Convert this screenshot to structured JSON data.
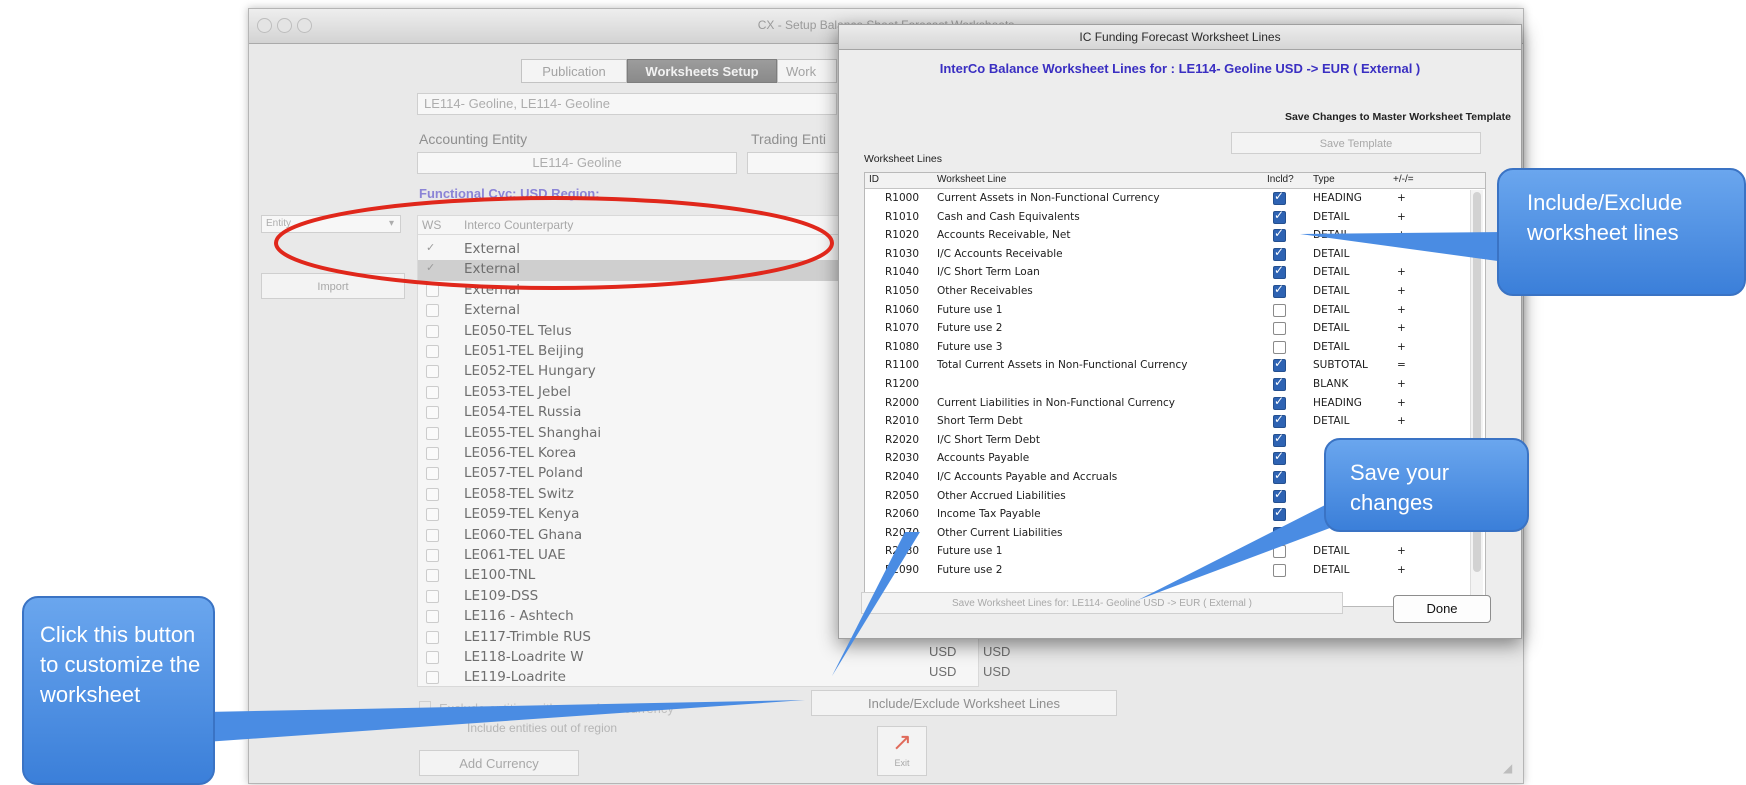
{
  "main_window": {
    "title": "CX - Setup Balance Sheet Forecast Worksheets",
    "tabs": [
      "Publication",
      "Worksheets Setup",
      "Work"
    ],
    "entity_combo": "LE114- Geoline, LE114- Geoline",
    "accounting_entity_label": "Accounting Entity",
    "accounting_entity_value": "LE114- Geoline",
    "trading_entity_label": "Trading Enti",
    "functional_ccy_label": "Functional Cyc: USD  Region:",
    "left_dropdown": "Entity",
    "left_button": "Import",
    "list_header_ws": "WS",
    "list_header_name": "Interco Counterparty",
    "counterparties": [
      {
        "name": "External",
        "checked": true
      },
      {
        "name": "External",
        "checked": true
      },
      {
        "name": "External",
        "checked": false
      },
      {
        "name": "External",
        "checked": false
      },
      {
        "name": "LE050-TEL Telus",
        "checked": false
      },
      {
        "name": "LE051-TEL Beijing",
        "checked": false
      },
      {
        "name": "LE052-TEL Hungary",
        "checked": false
      },
      {
        "name": "LE053-TEL Jebel",
        "checked": false
      },
      {
        "name": "LE054-TEL Russia",
        "checked": false
      },
      {
        "name": "LE055-TEL Shanghai",
        "checked": false
      },
      {
        "name": "LE056-TEL Korea",
        "checked": false
      },
      {
        "name": "LE057-TEL Poland",
        "checked": false
      },
      {
        "name": "LE058-TEL Switz",
        "checked": false
      },
      {
        "name": "LE059-TEL Kenya",
        "checked": false
      },
      {
        "name": "LE060-TEL Ghana",
        "checked": false
      },
      {
        "name": "LE061-TEL UAE",
        "checked": false
      },
      {
        "name": "LE100-TNL",
        "checked": false
      },
      {
        "name": "LE109-DSS",
        "checked": false
      },
      {
        "name": "LE116 - Ashtech",
        "checked": false
      },
      {
        "name": "LE117-Trimble RUS",
        "checked": false
      },
      {
        "name": "LE118-Loadrite W",
        "checked": false
      },
      {
        "name": "LE119-Loadrite",
        "checked": false
      }
    ],
    "currency_rows": [
      [
        "USD",
        "USD"
      ],
      [
        "USD",
        "USD"
      ],
      [
        "USD",
        "USD"
      ]
    ],
    "exclude_checkbox_label": "Exclude entities with same func currency",
    "exclude_sub_label": "Include entities out of region",
    "include_exclude_button": "Include/Exclude Worksheet Lines",
    "add_currency_button": "Add Currency",
    "exit_label": "Exit"
  },
  "dialog": {
    "title": "IC Funding Forecast Worksheet Lines",
    "subtitle": "InterCo Balance Worksheet Lines for : LE114- Geoline USD -> EUR ( External )",
    "save_template_label": "Save Changes to Master Worksheet Template",
    "save_template_button": "Save Template",
    "worksheet_lines_label": "Worksheet Lines",
    "columns": {
      "id": "ID",
      "line": "Worksheet Line",
      "incl": "Incld?",
      "type": "Type",
      "sign": "+/-/="
    },
    "rows": [
      {
        "id": "R1000",
        "line": "Current Assets in Non-Functional Currency",
        "incl": true,
        "type": "HEADING",
        "sign": "+"
      },
      {
        "id": "R1010",
        "line": "Cash and Cash Equivalents",
        "incl": true,
        "type": "DETAIL",
        "sign": "+"
      },
      {
        "id": "R1020",
        "line": "Accounts Receivable, Net",
        "incl": true,
        "type": "DETAIL",
        "sign": "+"
      },
      {
        "id": "R1030",
        "line": "I/C Accounts Receivable",
        "incl": true,
        "type": "DETAIL",
        "sign": ""
      },
      {
        "id": "R1040",
        "line": "I/C Short Term Loan",
        "incl": true,
        "type": "DETAIL",
        "sign": "+"
      },
      {
        "id": "R1050",
        "line": "Other Receivables",
        "incl": true,
        "type": "DETAIL",
        "sign": "+"
      },
      {
        "id": "R1060",
        "line": "Future use 1",
        "incl": false,
        "type": "DETAIL",
        "sign": "+"
      },
      {
        "id": "R1070",
        "line": "Future use 2",
        "incl": false,
        "type": "DETAIL",
        "sign": "+"
      },
      {
        "id": "R1080",
        "line": "Future use 3",
        "incl": false,
        "type": "DETAIL",
        "sign": "+"
      },
      {
        "id": "R1100",
        "line": "Total Current Assets in Non-Functional Currency",
        "incl": true,
        "type": "SUBTOTAL",
        "sign": "="
      },
      {
        "id": "R1200",
        "line": "",
        "incl": true,
        "type": "BLANK",
        "sign": "+"
      },
      {
        "id": "R2000",
        "line": "Current Liabilities in Non-Functional Currency",
        "incl": true,
        "type": "HEADING",
        "sign": "+"
      },
      {
        "id": "R2010",
        "line": "Short Term Debt",
        "incl": true,
        "type": "DETAIL",
        "sign": "+"
      },
      {
        "id": "R2020",
        "line": "I/C Short Term Debt",
        "incl": true,
        "type": "",
        "sign": ""
      },
      {
        "id": "R2030",
        "line": "Accounts Payable",
        "incl": true,
        "type": "",
        "sign": ""
      },
      {
        "id": "R2040",
        "line": "I/C Accounts Payable and Accruals",
        "incl": true,
        "type": "",
        "sign": ""
      },
      {
        "id": "R2050",
        "line": "Other Accrued Liabilities",
        "incl": true,
        "type": "",
        "sign": ""
      },
      {
        "id": "R2060",
        "line": "Income Tax Payable",
        "incl": true,
        "type": "",
        "sign": ""
      },
      {
        "id": "R2070",
        "line": "Other Current Liabilities",
        "incl": true,
        "type": "",
        "sign": ""
      },
      {
        "id": "R2080",
        "line": "Future use 1",
        "incl": false,
        "type": "DETAIL",
        "sign": "+"
      },
      {
        "id": "R2090",
        "line": "Future use 2",
        "incl": false,
        "type": "DETAIL",
        "sign": "+"
      }
    ],
    "save_lines_button": "Save Worksheet Lines for: LE114- Geoline USD -> EUR ( External )",
    "done_button": "Done"
  },
  "callouts": {
    "include_exclude": "Include/Exclude worksheet lines",
    "save_changes": "Save your changes",
    "click_button": "Click this button to customize the worksheet"
  },
  "colors": {
    "callout": "#4a8ce3",
    "highlight_ellipse": "#e0271b",
    "dialog_subtitle": "#3a2fc2"
  }
}
